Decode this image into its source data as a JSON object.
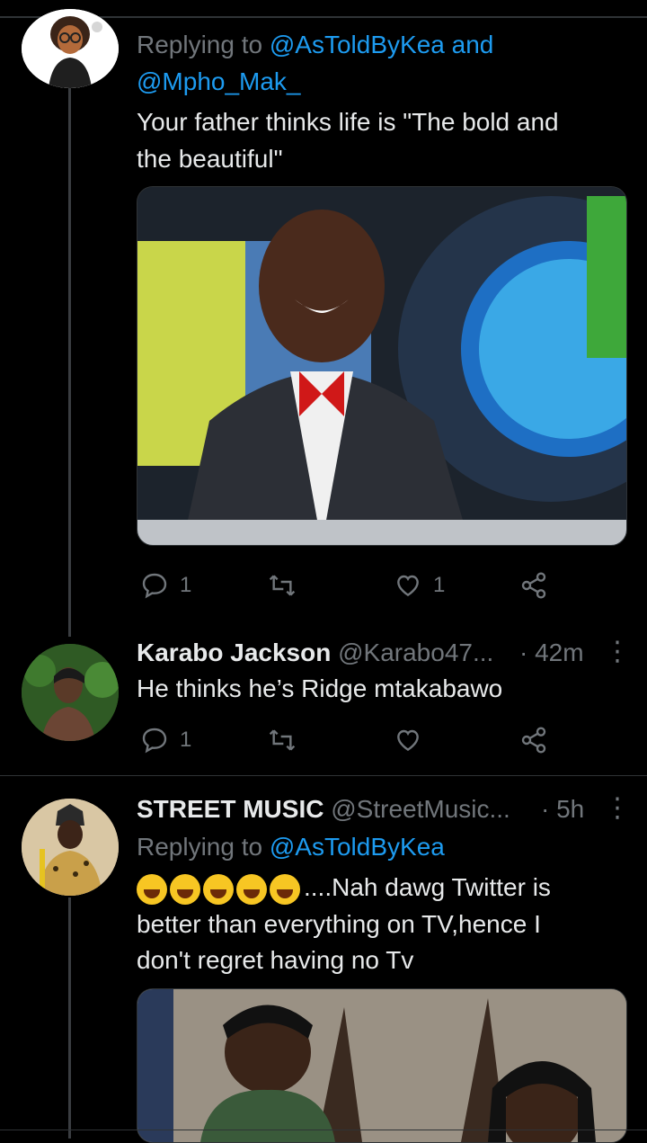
{
  "tweet1": {
    "replying_label": "Replying to",
    "replying_to": "@AsToldByKea and",
    "replying_to_2": "@Mpho_Mak_",
    "text_line1": "Your father thinks life is \"The bold and",
    "text_line2": "the beautiful\"",
    "media_icon": "photo-laughing-man",
    "stats": {
      "replies": "1",
      "likes": "1"
    }
  },
  "tweet2": {
    "name": "Karabo Jackson",
    "handle": "@Karabo47...",
    "time": "· 42m",
    "text": "He thinks he’s Ridge mtakabawo",
    "stats": {
      "replies": "1"
    }
  },
  "tweet3": {
    "name": "STREET MUSIC",
    "handle": "@StreetMusic...",
    "time": "· 5h",
    "replying_label": "Replying to",
    "replying_to": "@AsToldByKea",
    "emoji_names": [
      "joy-emoji",
      "joy-emoji",
      "joy-emoji",
      "joy-emoji",
      "rofl-emoji"
    ],
    "text_line1": "....Nah dawg Twitter is",
    "text_line2": "better than everything on TV,hence I",
    "text_line3": "don't regret having no Tv",
    "media_icon": "photo-two-men"
  },
  "colors": {
    "background": "#000000",
    "text": "#e7e9ea",
    "muted": "#71767b",
    "link": "#1d9bf0",
    "divider": "#2f3336"
  }
}
